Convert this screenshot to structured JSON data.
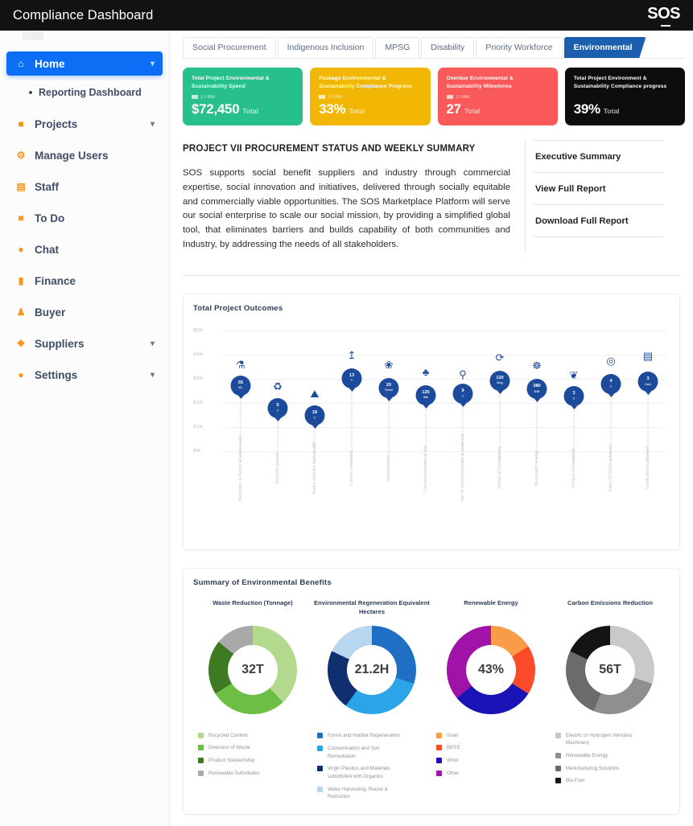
{
  "topbar": {
    "title": "Compliance Dashboard",
    "logo": "SOS"
  },
  "sidebar": {
    "items": [
      {
        "label": "Home",
        "icon": "home-icon",
        "glyph": "⌂",
        "active": true,
        "chevron": true
      },
      {
        "label": "Reporting Dashboard",
        "sub": true
      },
      {
        "label": "Projects",
        "icon": "briefcase-icon",
        "glyph": "■",
        "chevron": true
      },
      {
        "label": "Manage Users",
        "icon": "gear-icon",
        "glyph": "⚙"
      },
      {
        "label": "Staff",
        "icon": "id-card-icon",
        "glyph": "▤"
      },
      {
        "label": "To Do",
        "icon": "clipboard-icon",
        "glyph": "■"
      },
      {
        "label": "Chat",
        "icon": "chat-icon",
        "glyph": "●"
      },
      {
        "label": "Finance",
        "icon": "document-icon",
        "glyph": "▮"
      },
      {
        "label": "Buyer",
        "icon": "user-icon",
        "glyph": "♟"
      },
      {
        "label": "Suppliers",
        "icon": "truck-icon",
        "glyph": "❖",
        "chevron": true
      },
      {
        "label": "Settings",
        "icon": "cog-icon",
        "glyph": "●",
        "chevron": true
      }
    ]
  },
  "tabs": [
    {
      "label": "Social Procurement",
      "active": false
    },
    {
      "label": "Indigenous Inclusion",
      "active": false
    },
    {
      "label": "MPSG",
      "active": false
    },
    {
      "label": "Disability",
      "active": false
    },
    {
      "label": "Priority Workforce",
      "active": false
    },
    {
      "label": "Environmental",
      "active": true
    }
  ],
  "kpis": [
    {
      "title": "Total Project Environmental & Sustainability Spend",
      "filter": "1 Filter",
      "value": "$72,450",
      "unit": "Total",
      "color": "#27c08a"
    },
    {
      "title": "Package Environmental & Sustainability Compliance Progress",
      "filter": "1 Filter",
      "value": "33%",
      "unit": "Total",
      "color": "#f2b705"
    },
    {
      "title": "Overdue Environmental & Sustainability Milestones",
      "filter": "1 Filter",
      "value": "27",
      "unit": "Total",
      "color": "#fb5a5a"
    },
    {
      "title": "Total Project Environment & Sustainability Compliance progress",
      "filter": "",
      "value": "39%",
      "unit": "Total",
      "color": "#0d0d0d"
    }
  ],
  "summary": {
    "heading": "PROJECT VII PROCUREMENT STATUS AND WEEKLY SUMMARY",
    "body": "SOS supports social benefit suppliers and industry through commercial expertise, social innovation and initiatives, delivered through socially equitable and commercially viable opportunities. The SOS Marketplace Platform will serve our social enterprise to scale our social mission, by providing a simplified global tool, that eliminates barriers and builds capability of both communities and Industry, by addressing the needs of all stakeholders.",
    "links": [
      {
        "label": "Executive Summary"
      },
      {
        "label": "View Full Report"
      },
      {
        "label": "Download Full Report"
      }
    ]
  },
  "chart_data": [
    {
      "type": "scatter",
      "title": "Total Project Outcomes",
      "xlabel": "",
      "ylabel": "",
      "ylim": [
        0,
        50000
      ],
      "yticks": [
        "$0K",
        "$10K",
        "$20K",
        "$30K",
        "$40K",
        "$50K"
      ],
      "grid": true,
      "points": [
        {
          "category": "Rainwater & Reuse of waste water",
          "value": "55",
          "unit": "KL",
          "y": 30000,
          "icon": "tap-icon",
          "glyph": "⚗",
          "icon_y": 38000
        },
        {
          "category": "Recycle content",
          "value": "5",
          "unit": "T",
          "y": 20500,
          "icon": "recycle-icon",
          "glyph": "♻",
          "icon_y": 29000
        },
        {
          "category": "Waste diverted from landfill",
          "value": "18",
          "unit": "T",
          "y": 17500,
          "icon": "landfill-icon",
          "glyph": "⛰",
          "icon_y": 26000
        },
        {
          "category": "Carbon emissions",
          "value": "13",
          "unit": "T",
          "y": 33000,
          "icon": "upload-icon",
          "glyph": "↥",
          "icon_y": 42000
        },
        {
          "category": "Revegetation",
          "value": "20",
          "unit": "Trees",
          "y": 29000,
          "icon": "seedling-hand-icon",
          "glyph": "❀",
          "icon_y": 38000
        },
        {
          "category": "Decontamination of soil",
          "value": "120",
          "unit": "M3",
          "y": 26000,
          "icon": "plant-icon",
          "glyph": "♣",
          "icon_y": 35000
        },
        {
          "category": "Use of recycled plastics & materials",
          "value": "9",
          "unit": "T",
          "y": 26500,
          "icon": "bottle-icon",
          "glyph": "⚲",
          "icon_y": 34000
        },
        {
          "category": "Tonnes of Circularities",
          "value": "120",
          "unit": "Deg",
          "y": 32000,
          "icon": "circular-arrows-icon",
          "glyph": "⟳",
          "icon_y": 41000
        },
        {
          "category": "Renewable energy",
          "value": "380",
          "unit": "KW",
          "y": 28500,
          "icon": "wind-turbine-icon",
          "glyph": "☸",
          "icon_y": 37500
        },
        {
          "category": "Product Stewardship",
          "value": "3",
          "unit": "T",
          "y": 25500,
          "icon": "hands-care-icon",
          "glyph": "❦",
          "icon_y": 33500
        },
        {
          "category": "Total UN SDGs achieved",
          "value": "4",
          "unit": "T",
          "y": 30500,
          "icon": "target-icon",
          "glyph": "◎",
          "icon_y": 39500
        },
        {
          "category": "Certifications obtained",
          "value": "3",
          "unit": "Cert",
          "y": 31500,
          "icon": "certificate-icon",
          "glyph": "▤",
          "icon_y": 41500
        }
      ]
    },
    {
      "type": "pie",
      "title": "Waste Reduction (Tonnage)",
      "center_value": "32T",
      "labels": [
        "Recycled Content",
        "Diversion of Waste",
        "Product Stewardship",
        "Renewable Substitutes"
      ],
      "values": [
        38,
        28,
        20,
        14
      ],
      "colors": [
        "#b3d98e",
        "#6cbe45",
        "#3d7a22",
        "#a9a9a9"
      ]
    },
    {
      "type": "pie",
      "title": "Environmental Regeneration Equivalent Hectares",
      "center_value": "21.2H",
      "labels": [
        "Forest and Habitat Regeneration",
        "Contamination and Soil Remediation",
        "Virgin Plastics and Materials substituted with Organics",
        "Water Harvesting, Reuse & Reduction"
      ],
      "values": [
        30,
        30,
        22,
        18
      ],
      "colors": [
        "#1f6fc4",
        "#2ca5e8",
        "#0f2f6e",
        "#b9d6ef"
      ]
    },
    {
      "type": "pie",
      "title": "Renewable Energy",
      "center_value": "43%",
      "labels": [
        "Solar",
        "BESS",
        "Wind",
        "Other"
      ],
      "values": [
        16,
        18,
        30,
        36
      ],
      "colors": [
        "#f89c4a",
        "#fb4b2b",
        "#1a13b5",
        "#a012a8"
      ]
    },
    {
      "type": "pie",
      "title": "Carbon Emissions Reduction",
      "center_value": "56T",
      "labels": [
        "Electric or Hydrogen Vehicles/ Machinery",
        "Renewable Energy",
        "Manufacturing Solutions",
        "Bio-Fuel"
      ],
      "values": [
        30,
        26,
        26,
        18
      ],
      "colors": [
        "#c9c9c9",
        "#8f8f8f",
        "#6b6b6b",
        "#141414"
      ]
    }
  ],
  "panels": {
    "outcomes_title": "Total Project Outcomes",
    "benefits_title": "Summary of Environmental Benefits"
  }
}
